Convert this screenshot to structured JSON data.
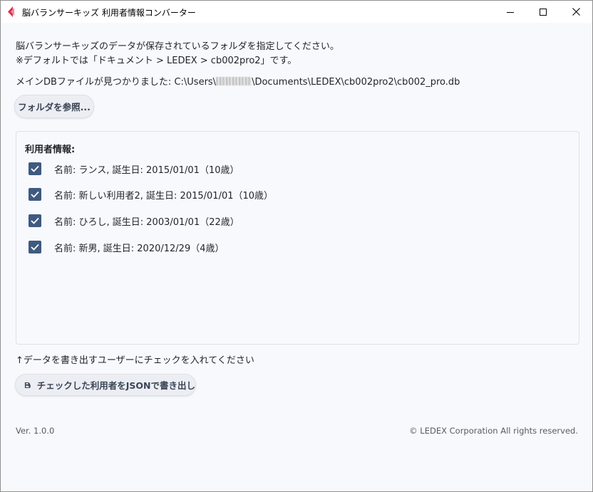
{
  "window": {
    "title": "脳バランサーキッズ 利用者情報コンバーター",
    "icon": "app-logo-icon",
    "controls": [
      "minimize-icon",
      "maximize-icon",
      "close-icon"
    ]
  },
  "info": {
    "line1": "脳バランサーキッズのデータが保存されているフォルダを指定してください。",
    "line2": "※デフォルトでは「ドキュメント > LEDEX > cb002pro2」です。",
    "db_found_prefix": "メインDBファイルが見つかりました: C:\\Users\\",
    "db_found_suffix": "\\Documents\\LEDEX\\cb002pro2\\cb002_pro.db"
  },
  "buttons": {
    "browse_label": "フォルダを参照...",
    "export_label": "チェックした利用者をJSONで書き出し"
  },
  "users_panel": {
    "title": "利用者情報:",
    "items": [
      {
        "label": "名前: ランス, 誕生日: 2015/01/01（10歳）",
        "checked": true
      },
      {
        "label": "名前: 新しい利用者2, 誕生日: 2015/01/01（10歳）",
        "checked": true
      },
      {
        "label": "名前: ひろし, 誕生日: 2003/01/01（22歳）",
        "checked": true
      },
      {
        "label": "名前: 新男, 誕生日: 2020/12/29（4歳）",
        "checked": true
      }
    ]
  },
  "hint": "↑データを書き出すユーザーにチェックを入れてください",
  "footer": {
    "version": "Ver. 1.0.0",
    "copyright": "© LEDEX Corporation All rights reserved."
  },
  "colors": {
    "checkbox": "#3f5a7f",
    "button_bg": "#eceef3",
    "window_bg": "#f8f9fc",
    "logo_red": "#e0304a",
    "logo_pink": "#f28aa0"
  }
}
